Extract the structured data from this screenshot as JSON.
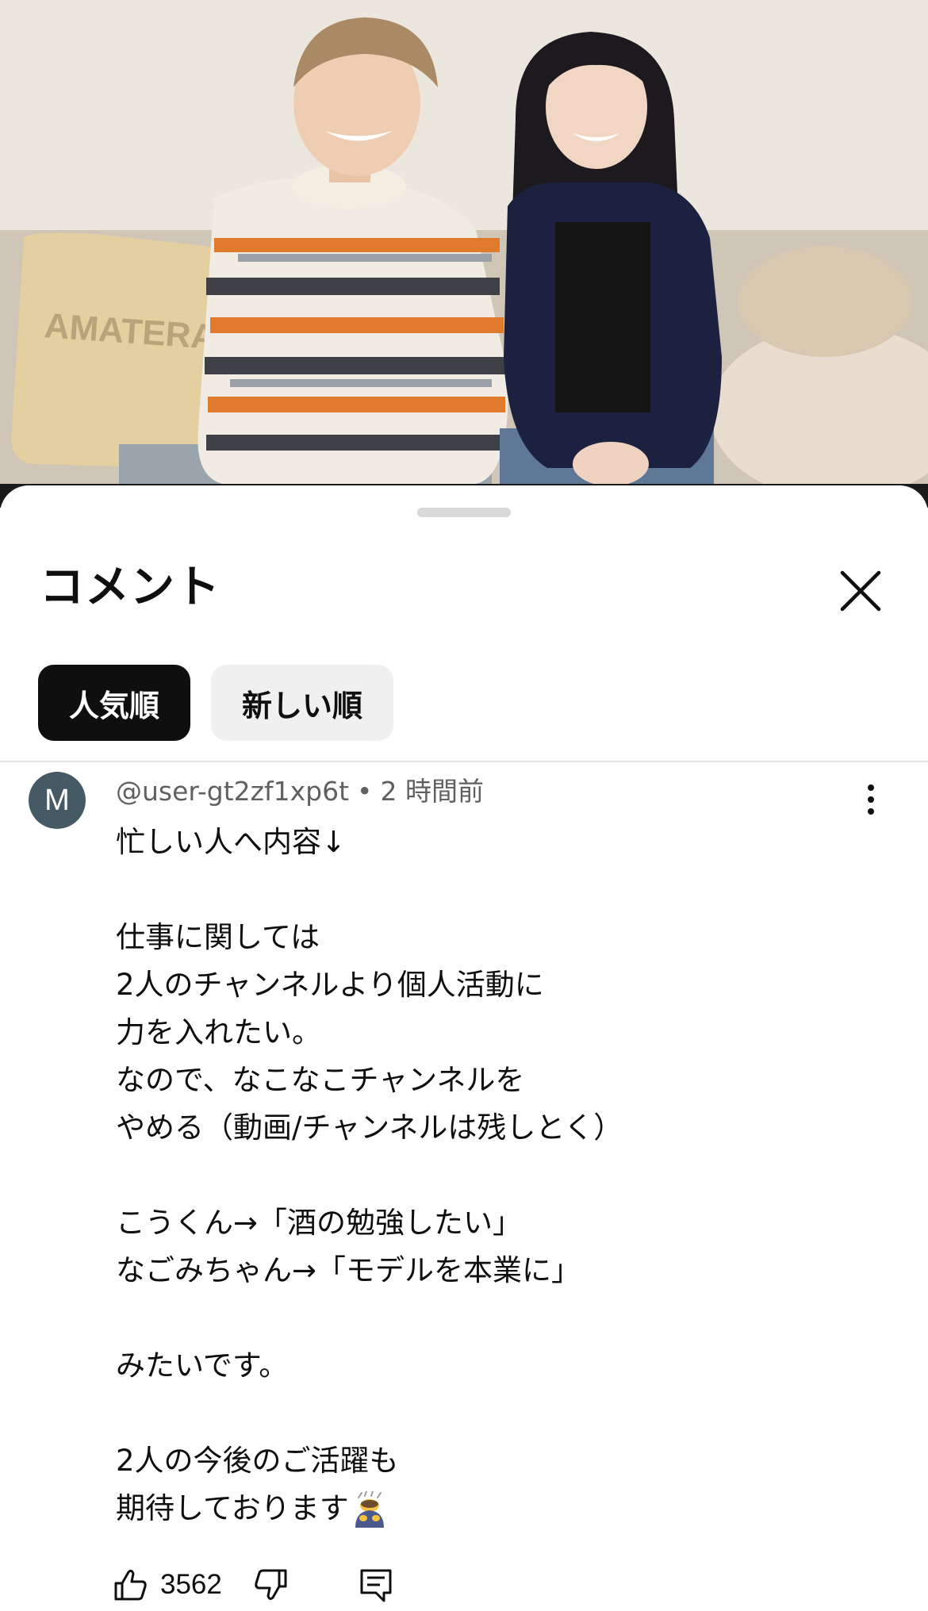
{
  "sheet": {
    "title": "コメント",
    "close_icon": "close-icon"
  },
  "sort_chips": [
    {
      "label": "人気順",
      "selected": true
    },
    {
      "label": "新しい順",
      "selected": false
    }
  ],
  "comment": {
    "avatar_letter": "M",
    "avatar_color": "#455a64",
    "author": "@user-gt2zf1xp6t",
    "separator": "•",
    "time": "2 時間前",
    "lines": [
      "忙しい人へ内容↓",
      "",
      "仕事に関しては",
      "2人のチャンネルより個人活動に",
      "力を入れたい。",
      "なので、なこなこチャンネルを",
      "やめる（動画/チャンネルは残しとく）",
      "",
      "こうくん→「酒の勉強したい」",
      "なごみちゃん→「モデルを本業に」",
      "",
      "みたいです。",
      "",
      "2人の今後のご活躍も",
      "期待しております"
    ],
    "trailing_emoji": "bowing-person-emoji",
    "like_count": "3562",
    "icons": {
      "like": "thumbs-up-icon",
      "dislike": "thumbs-down-icon",
      "reply": "reply-comment-icon",
      "more": "more-vertical-icon"
    }
  },
  "video": {
    "pillow_text": "AMATERA"
  }
}
